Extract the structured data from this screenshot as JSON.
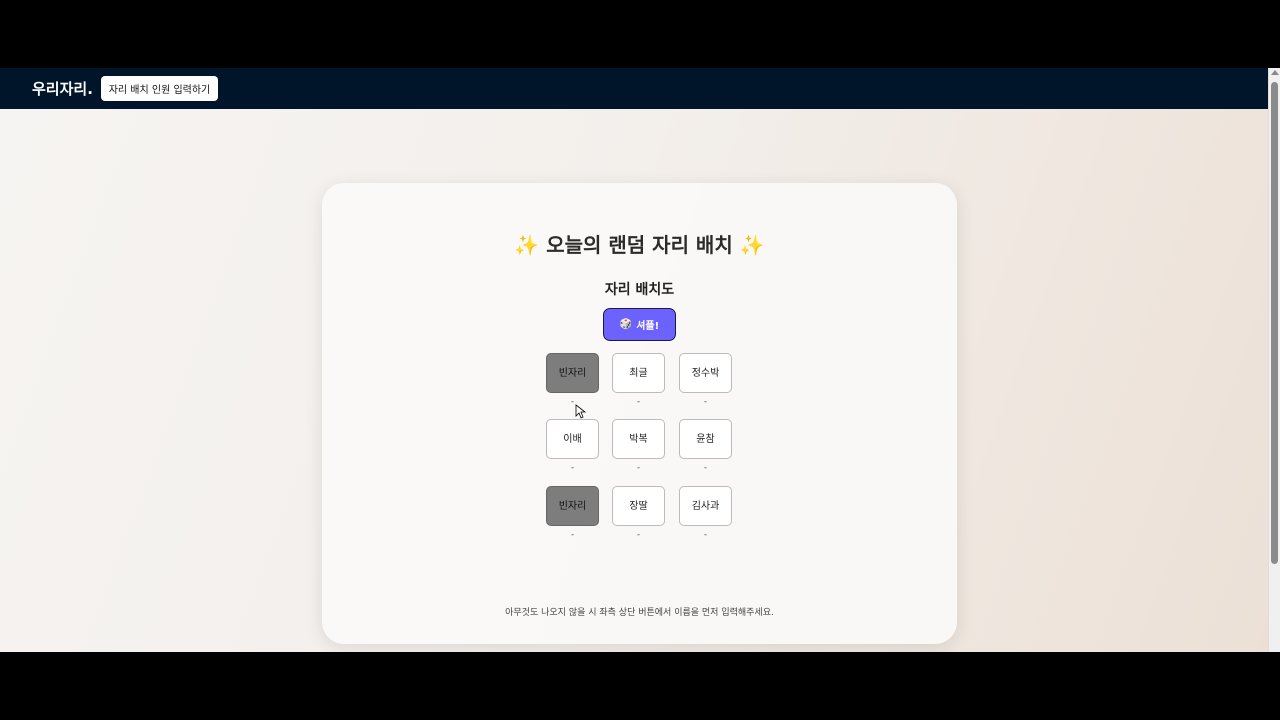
{
  "navbar": {
    "brand": "우리자리.",
    "input_button": "자리 배치 인원 입력하기"
  },
  "card": {
    "title": "✨ 오늘의 랜덤 자리 배치 ✨",
    "subtitle": "자리 배치도",
    "shuffle_icon": "🎲",
    "shuffle_label": "셔플!",
    "footer_note": "아무것도 나오지 않을 시 좌측 상단 버튼에서 이름을 먼저 입력해주세요."
  },
  "seats": [
    {
      "name": "빈자리",
      "sub": "-",
      "empty": true
    },
    {
      "name": "최글",
      "sub": "-",
      "empty": false
    },
    {
      "name": "정수박",
      "sub": "-",
      "empty": false
    },
    {
      "name": "이배",
      "sub": "-",
      "empty": false
    },
    {
      "name": "박복",
      "sub": "-",
      "empty": false
    },
    {
      "name": "윤참",
      "sub": "-",
      "empty": false
    },
    {
      "name": "빈자리",
      "sub": "-",
      "empty": true
    },
    {
      "name": "장딸",
      "sub": "-",
      "empty": false
    },
    {
      "name": "김사과",
      "sub": "-",
      "empty": false
    }
  ],
  "colors": {
    "navbar_bg": "#00142a",
    "shuffle_bg": "#6c63ff",
    "empty_seat_bg": "#7d7d7d"
  }
}
